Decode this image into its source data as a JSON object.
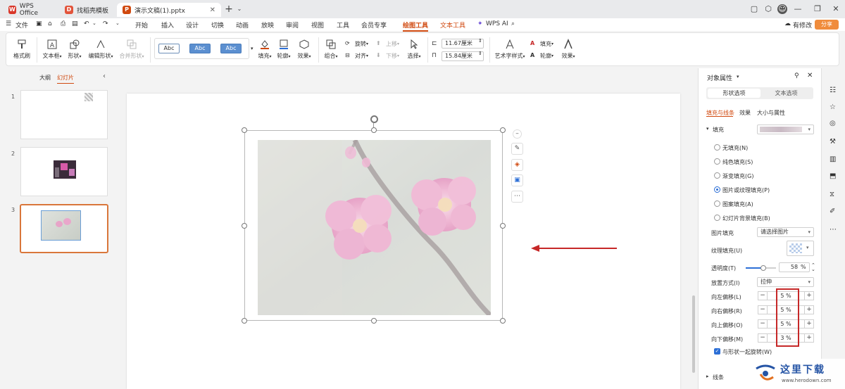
{
  "titlebar": {
    "tabs": [
      {
        "label": "WPS Office",
        "icon": "wps-logo-icon"
      },
      {
        "label": "找稻壳模板",
        "icon": "docer-logo-icon"
      },
      {
        "label": "演示文稿(1).pptx",
        "icon": "presentation-file-icon"
      }
    ]
  },
  "menubar": {
    "file": "文件",
    "items": [
      "开始",
      "插入",
      "设计",
      "切换",
      "动画",
      "放映",
      "审阅",
      "视图",
      "工具",
      "会员专享",
      "绘图工具",
      "文本工具"
    ],
    "active": "绘图工具",
    "wps_ai": "WPS AI",
    "has_changes": "有修改",
    "share": "分享"
  },
  "ribbon": {
    "format_painter": "格式刷",
    "textbox": "文本框",
    "shape": "形状",
    "edit_shape": "编辑形状",
    "merge_shape": "合并形状",
    "style_samples": [
      "Abc",
      "Abc",
      "Abc"
    ],
    "fill": "填充",
    "outline": "轮廓",
    "effect": "效果",
    "group": "组合",
    "rotate": "旋转",
    "align": "对齐",
    "move_up": "上移",
    "move_down": "下移",
    "select": "选择",
    "width": "11.67厘米",
    "height": "15.84厘米",
    "art_text_style": "艺术字样式",
    "text_fill": "填充",
    "text_outline": "轮廓",
    "text_effect": "效果"
  },
  "left_panel": {
    "tab_outline": "大纲",
    "tab_slides": "幻灯片",
    "slide_numbers": [
      "1",
      "2",
      "3"
    ]
  },
  "right_panel": {
    "title": "对象属性",
    "tab_shape": "形状选项",
    "tab_text": "文本选项",
    "subtabs": [
      "填充与线条",
      "效果",
      "大小与属性"
    ],
    "fill_section": "填充",
    "fill_options": [
      "无填充(N)",
      "纯色填充(S)",
      "渐变填充(G)",
      "图片或纹理填充(P)",
      "图案填充(A)",
      "幻灯片背景填充(B)"
    ],
    "selected_fill": "图片或纹理填充(P)",
    "picture_fill_label": "图片填充",
    "picture_fill_value": "请选择图片",
    "texture_fill_label": "纹理填充(U)",
    "transparency_label": "透明度(T)",
    "transparency_value": "58",
    "transparency_unit": "%",
    "placement_label": "放置方式(I)",
    "placement_value": "拉伸",
    "offsets": [
      {
        "label": "向左偏移(L)",
        "value": "5",
        "unit": "%"
      },
      {
        "label": "向右偏移(R)",
        "value": "5",
        "unit": "%"
      },
      {
        "label": "向上偏移(O)",
        "value": "5",
        "unit": "%"
      },
      {
        "label": "向下偏移(M)",
        "value": "3",
        "unit": "%"
      }
    ],
    "rotate_with_shape": "与形状一起旋转(W)",
    "line_section": "线条"
  },
  "watermark": {
    "site_name": "这里下载",
    "site_url": "www.herodown.com"
  },
  "colors": {
    "accent": "#d0490f",
    "share": "#f08c3c",
    "highlight_box": "#c62828",
    "arrow": "#c62828"
  }
}
